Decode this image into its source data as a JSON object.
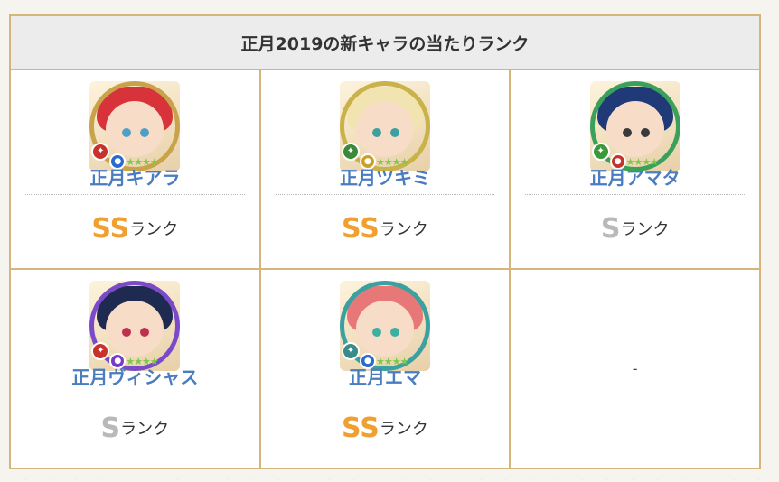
{
  "title": "正月2019の新キャラの当たりランク",
  "rank_suffix": "ランク",
  "characters": [
    {
      "name": "正月キアラ",
      "grade": "SS",
      "hair": "#d8323a",
      "eyes": "#4aa0c8",
      "ring": "#c9a34a",
      "weapon_color": "#c8322a",
      "element_color": "#2a6ac8",
      "weapon_icon": "bow-icon",
      "element_icon": "water-icon"
    },
    {
      "name": "正月ツキミ",
      "grade": "SS",
      "hair": "#f2e4b0",
      "eyes": "#3aa0a0",
      "ring": "#c9b24a",
      "weapon_color": "#3a8a3a",
      "element_color": "#c8a02a",
      "weapon_icon": "sword-icon",
      "element_icon": "thunder-icon"
    },
    {
      "name": "正月アマタ",
      "grade": "S",
      "hair": "#203a78",
      "eyes": "#3a3a3a",
      "ring": "#3aa05a",
      "weapon_color": "#3a9a3a",
      "element_color": "#c8322a",
      "weapon_icon": "arrow-icon",
      "element_icon": "fire-icon"
    },
    {
      "name": "正月ヴィシャス",
      "grade": "S",
      "hair": "#1e2a50",
      "eyes": "#c0304a",
      "ring": "#7a4ac8",
      "weapon_color": "#c8322a",
      "element_color": "#7a3ac8",
      "weapon_icon": "bow-icon",
      "element_icon": "dark-icon"
    },
    {
      "name": "正月エマ",
      "grade": "SS",
      "hair": "#e87878",
      "eyes": "#3ab0a0",
      "ring": "#3aa0a0",
      "weapon_color": "#3a8a8a",
      "element_color": "#2a6ac8",
      "weapon_icon": "wing-icon",
      "element_icon": "water-icon"
    }
  ],
  "empty_cell": "-",
  "stars": "★★★★"
}
